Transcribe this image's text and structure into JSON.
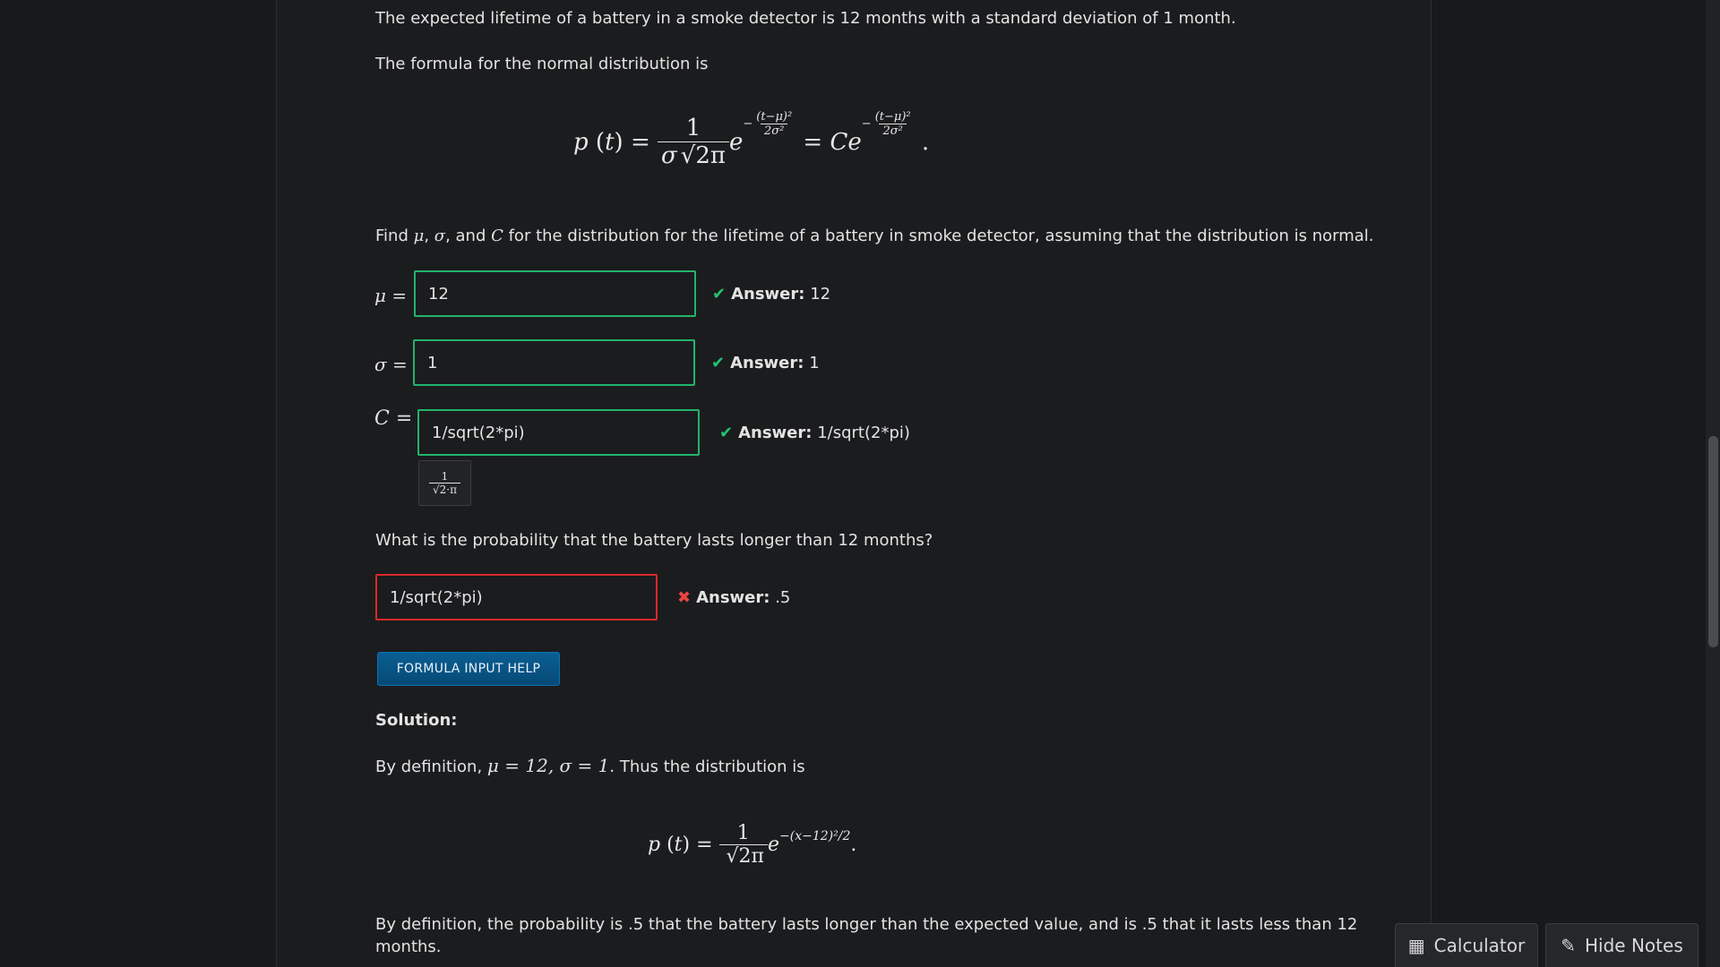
{
  "problem": {
    "intro": "The expected lifetime of a battery in a smoke detector is 12 months with a standard deviation of 1 month.",
    "formula_intro": "The formula for the normal distribution is",
    "find_prefix": "Find ",
    "find_suffix": " for the distribution for the lifetime of a battery in smoke detector, assuming that the distribution is normal."
  },
  "fields": {
    "mu": {
      "label": "μ =",
      "value": "12",
      "feedback_label": "Answer:",
      "feedback_value": "12",
      "status": "correct"
    },
    "sigma": {
      "label": "σ =",
      "value": "1",
      "feedback_label": "Answer:",
      "feedback_value": "1",
      "status": "correct"
    },
    "C": {
      "label": "C =",
      "value": "1/sqrt(2*pi)",
      "feedback_label": "Answer:",
      "feedback_value": "1/sqrt(2*pi)",
      "status": "correct"
    },
    "probability": {
      "value": "1/sqrt(2*pi)",
      "feedback_label": "Answer:",
      "feedback_value": ".5",
      "status": "incorrect"
    }
  },
  "question2": "What is the probability that the battery lasts longer than 12 months?",
  "help_button": "FORMULA INPUT HELP",
  "solution": {
    "heading": "Solution:",
    "definition_prefix": "By definition, ",
    "definition_suffix": ". Thus the distribution is",
    "conclusion": "By definition, the probability is .5 that the battery lasts longer than the expected value, and is .5 that it lasts less than 12",
    "conclusion_line2": "months."
  },
  "toolbar": {
    "calculator_label": "Calculator",
    "hide_notes_label": "Hide Notes"
  },
  "colors": {
    "correct": "#23b36b",
    "incorrect": "#d82a2a",
    "accent": "#0b5e93"
  }
}
